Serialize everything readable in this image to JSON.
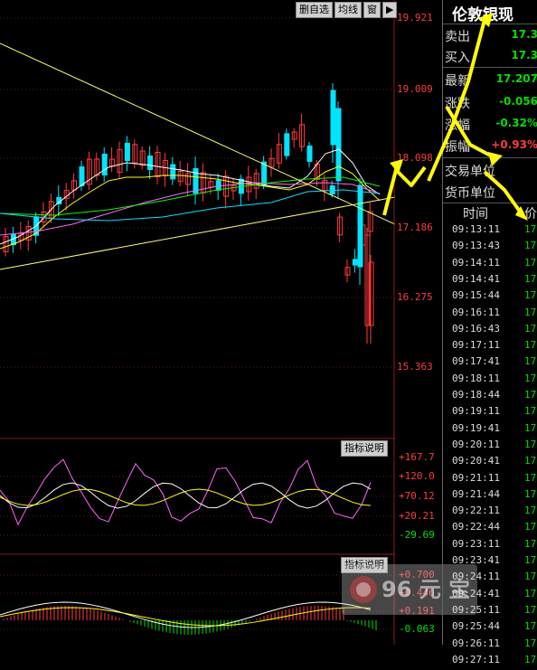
{
  "toolbar": {
    "delete_self": "删自选",
    "ma": "均线",
    "window": "窗",
    "play": "▶"
  },
  "instrument": {
    "name": "伦敦银现"
  },
  "price_axis": [
    "19.921",
    "19.009",
    "18.098",
    "17.186",
    "16.275",
    "15.363"
  ],
  "indicator1": {
    "button": "指标说明",
    "levels": [
      "+167.7",
      "+120.0",
      "+70.12",
      "+20.21",
      "-29.69"
    ]
  },
  "indicator2": {
    "button": "指标说明",
    "levels": [
      "+0.700",
      "+0.446",
      "+0.191",
      "-0.063"
    ]
  },
  "quote": {
    "sell_label": "卖出",
    "sell_value": "17.3",
    "buy_label": "买入",
    "buy_value": "17.3",
    "last_label": "最新",
    "last_value": "17.207",
    "change_label": "涨跌",
    "change_value": "-0.056",
    "pct_label": "涨幅",
    "pct_value": "-0.32%",
    "amp_label": "振幅",
    "amp_value": "+0.93%",
    "unit_label": "交易单位",
    "currency_label": "货币单位"
  },
  "ticks_header": {
    "time": "时间",
    "price": "价"
  },
  "ticks": [
    {
      "time": "09:13:11",
      "price": "17"
    },
    {
      "time": "09:13:43",
      "price": "17"
    },
    {
      "time": "09:14:11",
      "price": "17"
    },
    {
      "time": "09:14:41",
      "price": "17"
    },
    {
      "time": "09:15:44",
      "price": "17"
    },
    {
      "time": "09:16:11",
      "price": "17"
    },
    {
      "time": "09:16:43",
      "price": "17"
    },
    {
      "time": "09:17:11",
      "price": "17"
    },
    {
      "time": "09:17:41",
      "price": "17"
    },
    {
      "time": "09:18:11",
      "price": "17"
    },
    {
      "time": "09:18:44",
      "price": "17"
    },
    {
      "time": "09:19:11",
      "price": "17"
    },
    {
      "time": "09:19:41",
      "price": "17"
    },
    {
      "time": "09:20:11",
      "price": "17"
    },
    {
      "time": "09:20:41",
      "price": "17"
    },
    {
      "time": "09:21:11",
      "price": "17"
    },
    {
      "time": "09:21:44",
      "price": "17"
    },
    {
      "time": "09:22:11",
      "price": "17"
    },
    {
      "time": "09:22:44",
      "price": "17"
    },
    {
      "time": "09:23:11",
      "price": "17"
    },
    {
      "time": "09:23:41",
      "price": "17"
    },
    {
      "time": "09:24:11",
      "price": "17"
    },
    {
      "time": "09:24:41",
      "price": "17"
    },
    {
      "time": "09:25:11",
      "price": "17"
    },
    {
      "time": "09:25:44",
      "price": "17"
    },
    {
      "time": "09:26:11",
      "price": "17"
    },
    {
      "time": "09:27:11",
      "price": "17"
    }
  ],
  "watermark": "96 元 宝",
  "colors": {
    "up": "#ff3b3b",
    "down": "#00e5ff",
    "ma5": "#ffffff",
    "ma10": "#ffff00",
    "ma20": "#ff66ff",
    "ma60": "#00ff00",
    "trendline": "#ffff66",
    "arrow": "#ffff00"
  }
}
